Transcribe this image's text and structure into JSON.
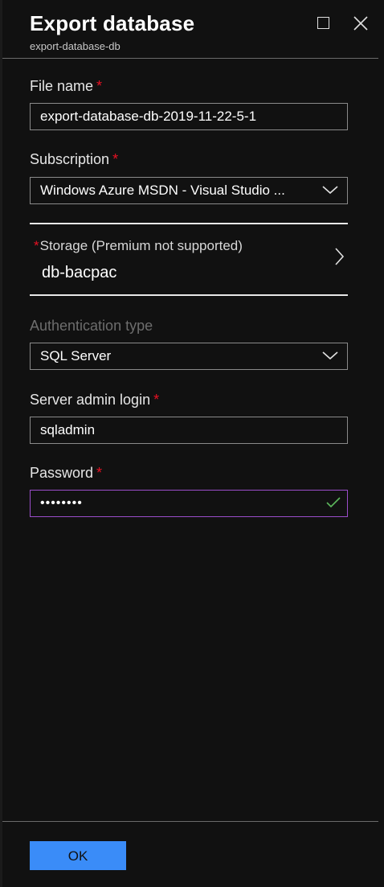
{
  "header": {
    "title": "Export database",
    "subtitle": "export-database-db",
    "maximize_icon": "maximize-icon",
    "close_icon": "close-icon"
  },
  "form": {
    "file_name": {
      "label": "File name",
      "required_mark": "*",
      "value": "export-database-db-2019-11-22-5-1"
    },
    "subscription": {
      "label": "Subscription",
      "required_mark": "*",
      "value": "Windows Azure MSDN - Visual Studio ..."
    },
    "storage": {
      "required_mark": "*",
      "label": "Storage (Premium not supported)",
      "value": "db-bacpac"
    },
    "authentication_type": {
      "label": "Authentication type",
      "value": "SQL Server"
    },
    "server_admin_login": {
      "label": "Server admin login",
      "required_mark": "*",
      "value": "sqladmin"
    },
    "password": {
      "label": "Password",
      "required_mark": "*",
      "value": "••••••••"
    }
  },
  "footer": {
    "ok_label": "OK"
  },
  "colors": {
    "background": "#111111",
    "required": "#e81123",
    "accent_button": "#3a8cf8",
    "focus_border": "#9b4dca",
    "valid_check": "#5cb85c"
  }
}
